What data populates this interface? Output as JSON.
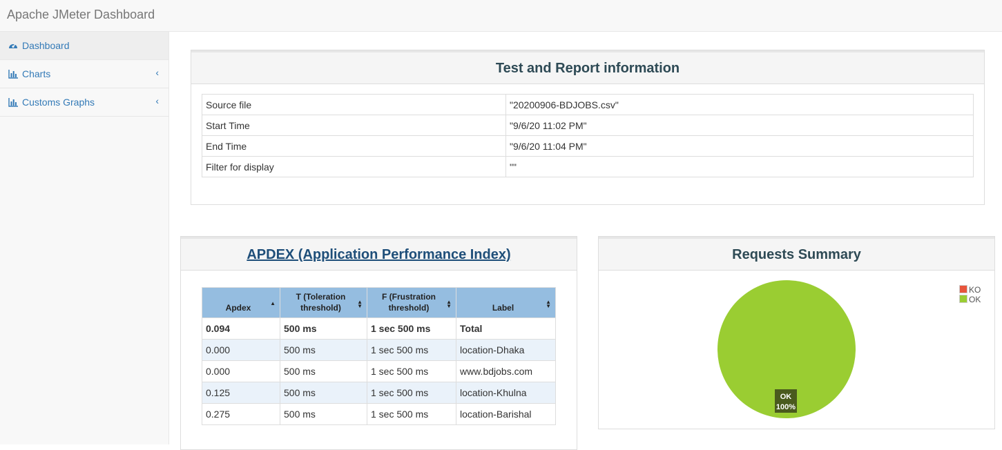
{
  "app": {
    "title": "Apache JMeter Dashboard"
  },
  "sidebar": {
    "items": [
      {
        "label": "Dashboard",
        "icon": "dashboard-icon"
      },
      {
        "label": "Charts",
        "icon": "bar-chart-icon"
      },
      {
        "label": "Customs Graphs",
        "icon": "bar-chart-icon"
      }
    ]
  },
  "test_info": {
    "title": "Test and Report information",
    "rows": [
      {
        "key": "Source file",
        "value": "\"20200906-BDJOBS.csv\""
      },
      {
        "key": "Start Time",
        "value": "\"9/6/20 11:02 PM\""
      },
      {
        "key": "End Time",
        "value": "\"9/6/20 11:04 PM\""
      },
      {
        "key": "Filter for display",
        "value": "\"\""
      }
    ]
  },
  "apdex": {
    "title": "APDEX (Application Performance Index)",
    "columns": [
      {
        "label": "Apdex"
      },
      {
        "label": "T (Toleration threshold)"
      },
      {
        "label": "F (Frustration threshold)"
      },
      {
        "label": "Label"
      }
    ],
    "rows": [
      [
        "0.094",
        "500 ms",
        "1 sec 500 ms",
        "Total"
      ],
      [
        "0.000",
        "500 ms",
        "1 sec 500 ms",
        "location-Dhaka"
      ],
      [
        "0.000",
        "500 ms",
        "1 sec 500 ms",
        "www.bdjobs.com"
      ],
      [
        "0.125",
        "500 ms",
        "1 sec 500 ms",
        "location-Khulna"
      ],
      [
        "0.275",
        "500 ms",
        "1 sec 500 ms",
        "location-Barishal"
      ]
    ]
  },
  "requests_summary": {
    "title": "Requests Summary",
    "legend": [
      {
        "label": "KO",
        "color": "#e8553c"
      },
      {
        "label": "OK",
        "color": "#9acd32"
      }
    ],
    "slice_label": "OK",
    "slice_percent": "100%"
  },
  "chart_data": {
    "type": "pie",
    "categories": [
      "KO",
      "OK"
    ],
    "values": [
      0,
      100
    ],
    "colors": [
      "#e8553c",
      "#9acd32"
    ]
  }
}
